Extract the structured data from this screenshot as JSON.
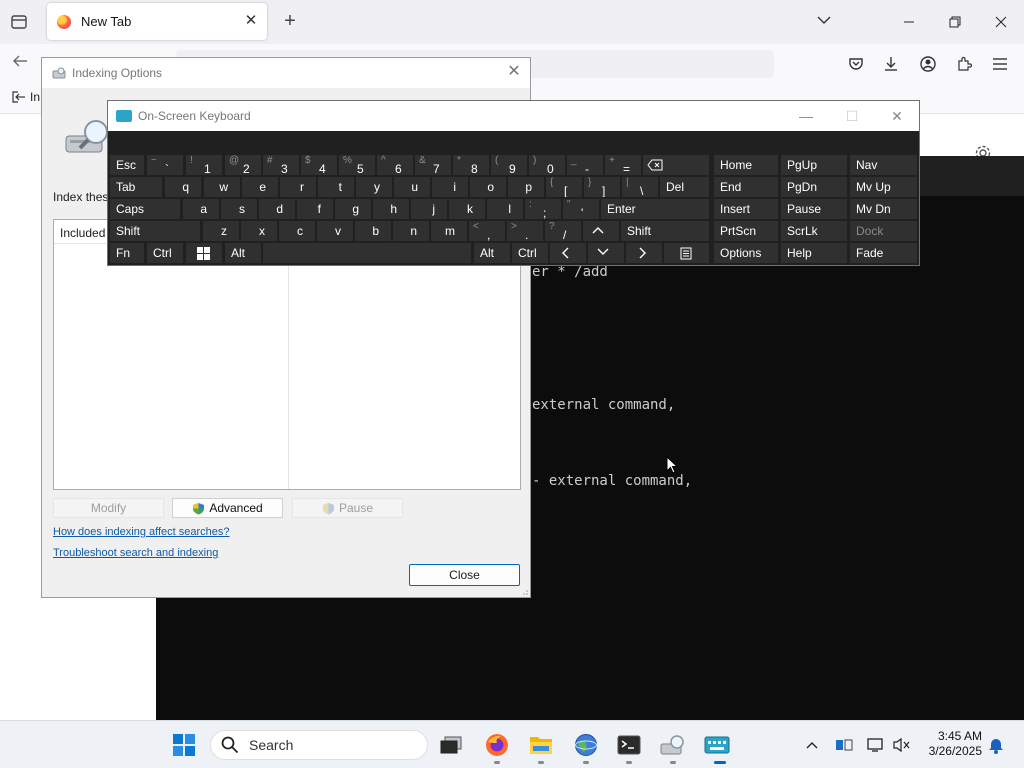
{
  "browser": {
    "tab_title": "New Tab",
    "bookmark_label": "In"
  },
  "terminal": {
    "lines": [
      "er * /add",
      "external command,",
      "- external command,"
    ]
  },
  "indexing": {
    "title": "Indexing Options",
    "index_label": "Index these locations:",
    "list_header": "Included Locations",
    "modify": "Modify",
    "advanced": "Advanced",
    "pause": "Pause",
    "link_how": "How does indexing affect searches?",
    "link_troubleshoot": "Troubleshoot search and indexing",
    "close": "Close"
  },
  "osk": {
    "title": "On-Screen Keyboard",
    "keys": {
      "esc": "Esc",
      "tab": "Tab",
      "caps": "Caps",
      "shift": "Shift",
      "fn": "Fn",
      "ctrl": "Ctrl",
      "alt": "Alt",
      "del": "Del",
      "enter": "Enter",
      "alt_r": "Alt",
      "ctrl_r": "Ctrl",
      "home": "Home",
      "pgup": "PgUp",
      "nav": "Nav",
      "end": "End",
      "pgdn": "PgDn",
      "mvup": "Mv Up",
      "insert": "Insert",
      "pause": "Pause",
      "mvdn": "Mv Dn",
      "prtscn": "PrtScn",
      "scrlk": "ScrLk",
      "dock": "Dock",
      "options": "Options",
      "help": "Help",
      "fade": "Fade",
      "tilde_sh": "~",
      "tilde": "`",
      "n1_sh": "!",
      "n1": "1",
      "n2_sh": "@",
      "n2": "2",
      "n3_sh": "#",
      "n3": "3",
      "n4_sh": "$",
      "n4": "4",
      "n5_sh": "%",
      "n5": "5",
      "n6_sh": "^",
      "n6": "6",
      "n7_sh": "&",
      "n7": "7",
      "n8_sh": "*",
      "n8": "8",
      "n9_sh": "(",
      "n9": "9",
      "n0_sh": ")",
      "n0": "0",
      "minus_sh": "_",
      "minus": "-",
      "eq_sh": "+",
      "eq": "=",
      "q": "q",
      "w": "w",
      "e": "e",
      "r": "r",
      "t": "t",
      "y": "y",
      "u": "u",
      "i": "i",
      "o": "o",
      "p": "p",
      "lb_sh": "{",
      "lb": "[",
      "rb_sh": "}",
      "rb": "]",
      "bs_sh": "|",
      "bs": "\\",
      "a": "a",
      "s": "s",
      "d": "d",
      "f": "f",
      "g": "g",
      "h": "h",
      "j": "j",
      "k": "k",
      "l": "l",
      "semi_sh": ":",
      "semi": ";",
      "quote_sh": "\"",
      "quote": "'",
      "z": "z",
      "x": "x",
      "c": "c",
      "v": "v",
      "b": "b",
      "n": "n",
      "m": "m",
      "comma_sh": "<",
      "comma": ",",
      "dot_sh": ">",
      "dot": ".",
      "slash_sh": "?",
      "slash": "/"
    }
  },
  "taskbar": {
    "search_placeholder": "Search",
    "time": "3:45 AM",
    "date": "3/26/2025"
  },
  "colors": {
    "terminal_bg": "#0c0c0c",
    "osk_bg": "#202020",
    "osk_key": "#303030",
    "link": "#0f5aa8",
    "accent": "#0067c0"
  }
}
